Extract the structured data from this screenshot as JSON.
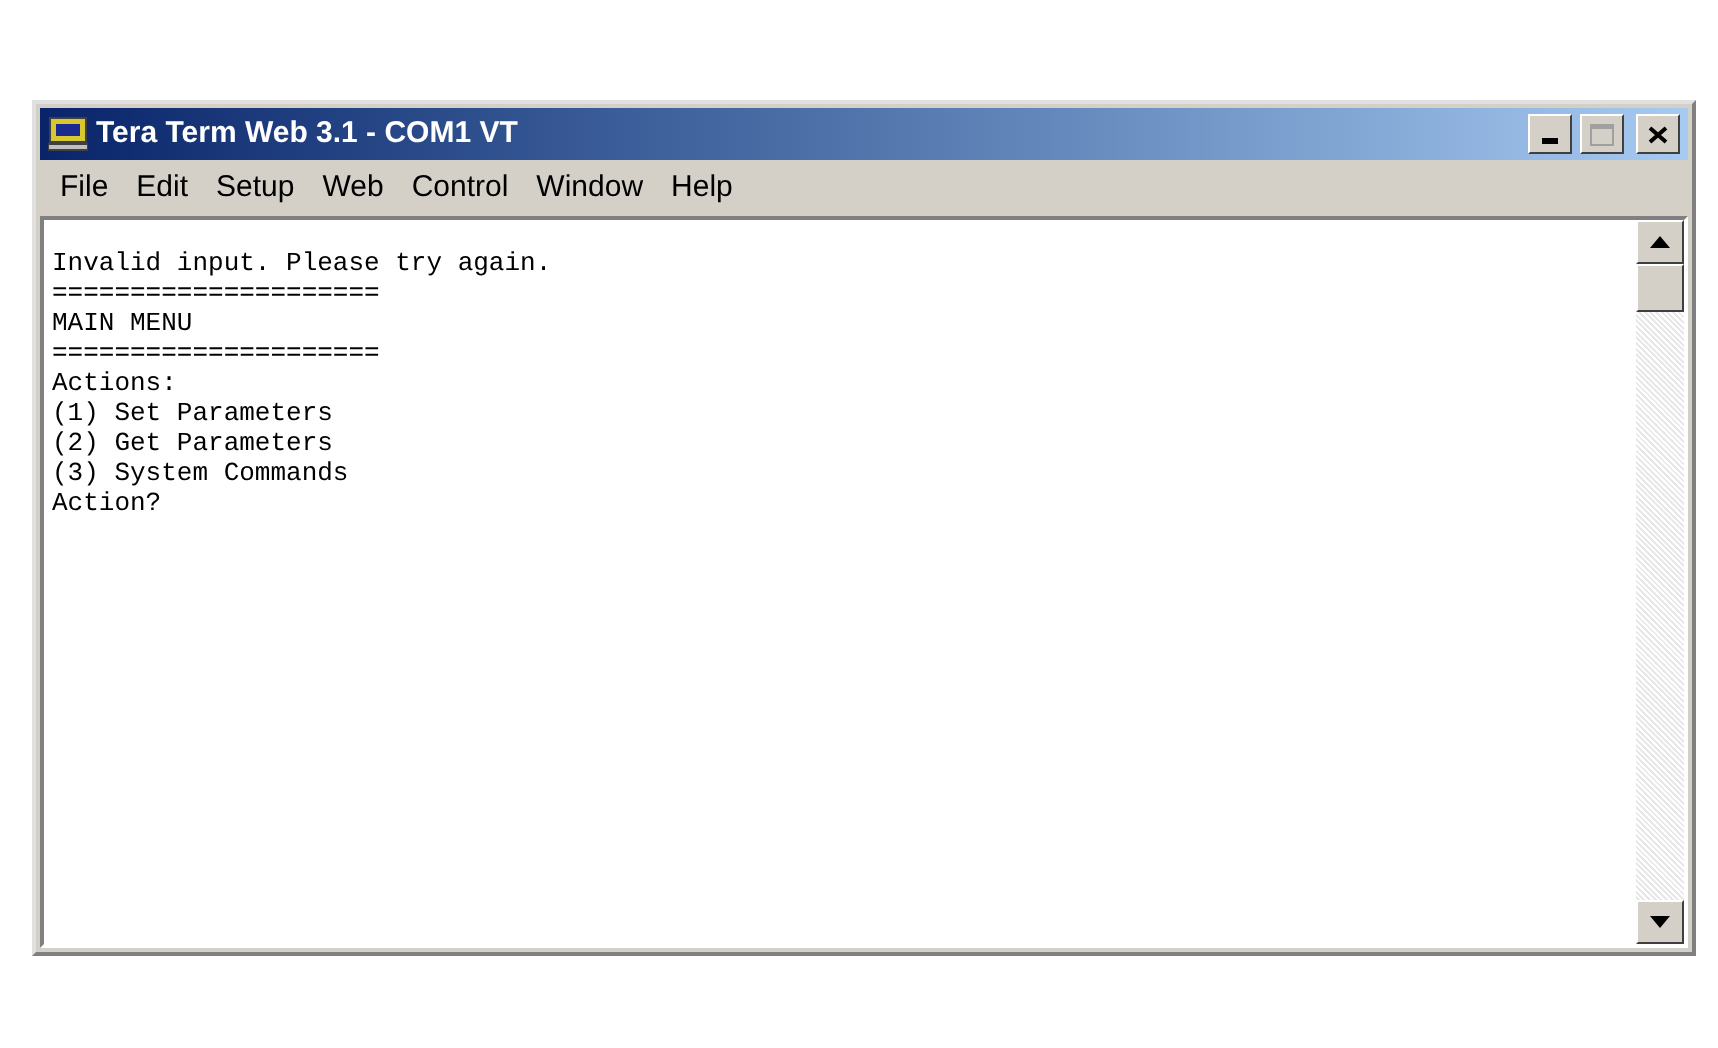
{
  "window": {
    "title": "Tera Term Web 3.1 - COM1 VT"
  },
  "menu": [
    "File",
    "Edit",
    "Setup",
    "Web",
    "Control",
    "Window",
    "Help"
  ],
  "terminal": {
    "lines": [
      "Invalid input. Please try again.",
      "=====================",
      "MAIN MENU",
      "=====================",
      "Actions:",
      "(1) Set Parameters",
      "(2) Get Parameters",
      "(3) System Commands",
      "Action?"
    ]
  }
}
